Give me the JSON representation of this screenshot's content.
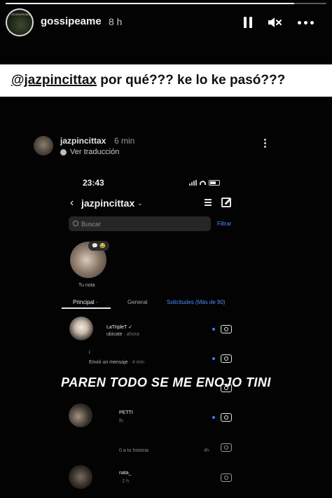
{
  "story": {
    "progress": 0.9,
    "username": "gossipeame",
    "time": "8 h",
    "avatar_label": "GOSSIPEAME",
    "icons": {
      "pause": "pause-icon",
      "mute": "speaker-muted-icon",
      "more": "more-horizontal-icon"
    }
  },
  "caption": {
    "mention": "@jazpincittax",
    "text": " por qué??? ke lo ke pasó???"
  },
  "reposted": {
    "username": "jazpincittax",
    "time": "6 min",
    "translate": "Ver traducción"
  },
  "inner_screen": {
    "status_time": "23:43",
    "header_back": "‹",
    "header_title": "jazpincittax",
    "header_caret": "⌄",
    "search_placeholder": "Buscar",
    "filter_label": "Filtrar",
    "note_bubble": "💬 😂",
    "note_label": "Tu nota",
    "tabs": [
      "Principal ·",
      "General",
      "Solicitudes (Más de 90)"
    ],
    "rows": [
      {
        "name": "LaTripleT ✓",
        "sub": "ubicate",
        "time": "· ahora"
      },
      {
        "name": "",
        "sub": "Envió un mensaje",
        "time": "· 4 min"
      },
      {
        "name": "PETTI",
        "sub": "",
        "time": "fh"
      },
      {
        "name": "",
        "sub": "",
        "time": ""
      },
      {
        "name": "nata_",
        "sub": "",
        "time": "· 2 h"
      }
    ],
    "row3_partial": "i",
    "row5_text": "0 a tu historia",
    "row5_time": "4h"
  },
  "overlay_text": "PAREN TODO SE ME ENOJO TINI",
  "colors": {
    "accent_blue": "#4d8cff",
    "unread_dot": "#3a7bff",
    "caption_bg": "#ffffff"
  }
}
